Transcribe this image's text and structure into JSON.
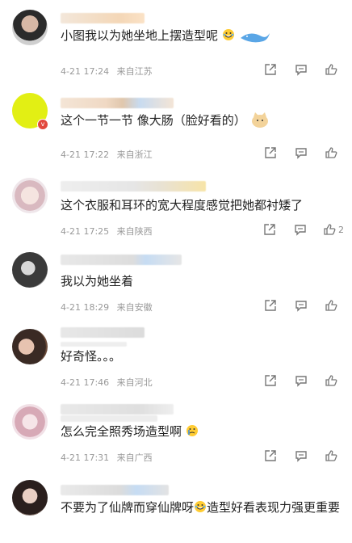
{
  "comments": [
    {
      "text": "小图我以为她坐地上摆造型呢",
      "time": "4-21 17:24",
      "source": "来自江苏",
      "likes": ""
    },
    {
      "text": "这个一节一节 像大肠（脸好看的）",
      "time": "4-21 17:22",
      "source": "来自浙江",
      "likes": ""
    },
    {
      "text": "这个衣服和耳环的宽大程度感觉把她都衬矮了",
      "time": "4-21 17:25",
      "source": "来自陕西",
      "likes": "2"
    },
    {
      "text": "我以为她坐着",
      "time": "4-21 18:29",
      "source": "来自安徽",
      "likes": ""
    },
    {
      "text": "好奇怪。。。",
      "time": "4-21 17:46",
      "source": "来自河北",
      "likes": ""
    },
    {
      "text": "怎么完全照秀场造型啊",
      "time": "4-21 17:31",
      "source": "来自广西",
      "likes": ""
    },
    {
      "text_a": "不要为了仙牌而穿仙牌呀",
      "text_b": "造型好看表现力强更重要",
      "time": "",
      "source": "",
      "likes": ""
    }
  ],
  "icons": {
    "share": "share-icon",
    "comment": "comment-icon",
    "like": "like-icon",
    "laugh": "laugh-cry-emoji",
    "crying": "crying-emoji"
  },
  "colors": {
    "verified_badge": "#e2483d",
    "meta_text": "#999999"
  }
}
